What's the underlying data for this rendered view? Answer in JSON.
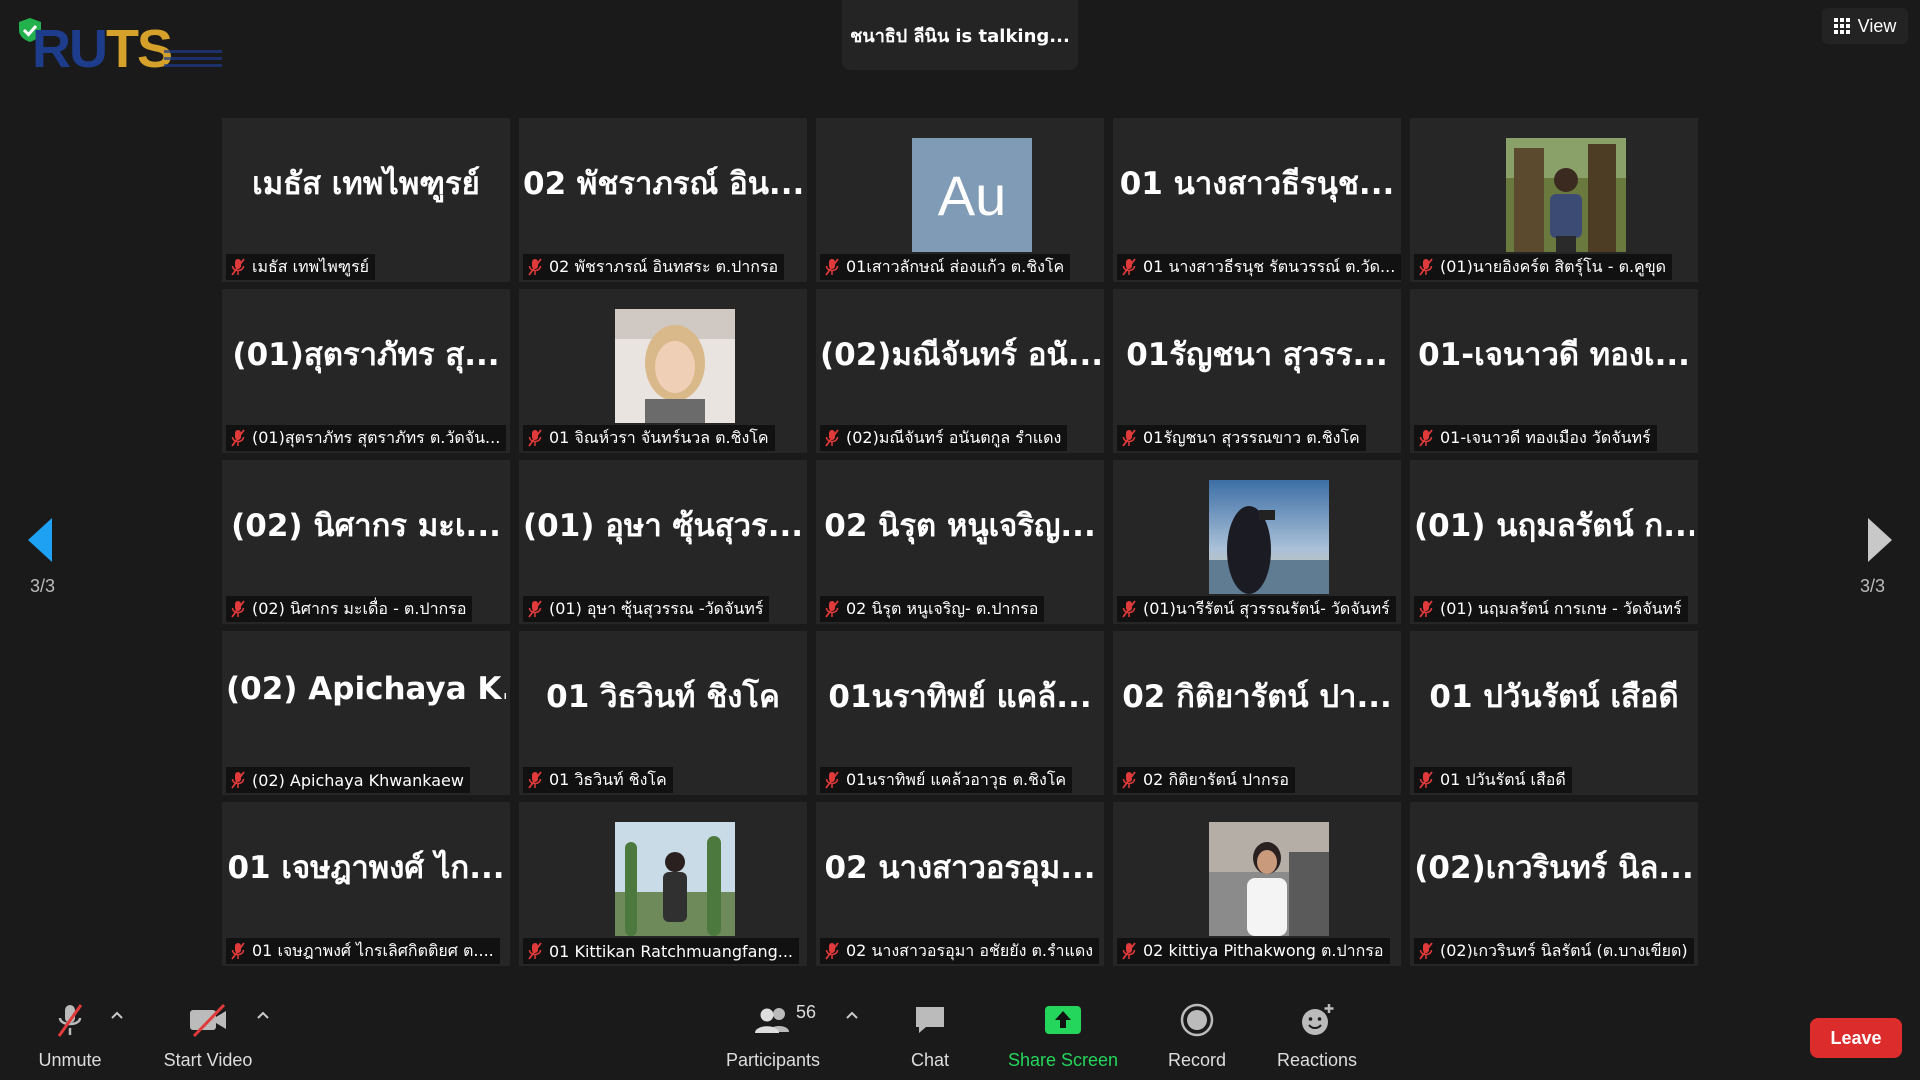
{
  "logo": {
    "text_a": "RU",
    "text_b": "TS"
  },
  "banner": {
    "talking": "ชนาธิป ลีนิน is talking..."
  },
  "view": {
    "label": "View"
  },
  "paging": {
    "left": "3/3",
    "right": "3/3"
  },
  "tiles": [
    {
      "big": "เมธัส เทพไพฑูรย์",
      "label": "เมธัส เทพไพฑูรย์"
    },
    {
      "big": "02 พัชราภรณ์ อิน...",
      "label": "02 พัชราภรณ์ อินทสระ ต.ปากรอ"
    },
    {
      "avatar": "Au",
      "label": "01เสาวลักษณ์ ส่องแก้ว ต.ชิงโค"
    },
    {
      "big": "01 นางสาวธีรนุช...",
      "label": "01 นางสาวธีรนุช รัตนวรรณ์ ต.วัด..."
    },
    {
      "photo": "man-outdoors",
      "label": "(01)นายอิงคร์ต สิตรุ์โน - ต.คูขุด"
    },
    {
      "big": "(01)สุตราภัทร สุ...",
      "label": "(01)สุตราภัทร สุตราภัทร ต.วัดจัน..."
    },
    {
      "photo": "woman-portrait",
      "label": "01 จิณห์วรา จันทร์นวล ต.ชิงโค"
    },
    {
      "big": "(02)มณีจันทร์ อนั...",
      "label": "(02)มณีจันทร์ อนันตกูล รำแดง"
    },
    {
      "big": "01รัญชนา สุวรร...",
      "label": "01รัญชนา สุวรรณขาว ต.ชิงโค"
    },
    {
      "big": "01-เจนาวดี ทองเ...",
      "label": "01-เจนาวดี ทองเมือง วัดจันทร์"
    },
    {
      "big": "(02) นิศากร มะเ...",
      "label": "(02) นิศากร มะเดื่อ - ต.ปากรอ"
    },
    {
      "big": "(01) อุษา ซุ้นสุวร...",
      "label": "(01) อุษา ซุ้นสุวรรณ -วัดจันทร์"
    },
    {
      "big": "02 นิรุต หนูเจริญ...",
      "label": "02 นิรุต หนูเจริญ- ต.ปากรอ"
    },
    {
      "photo": "sunset-photo",
      "label": "(01)นารีรัตน์ สุวรรณรัตน์- วัดจันทร์"
    },
    {
      "big": "(01) นฤมลรัตน์ ก...",
      "label": "(01) นฤมลรัตน์ การเกษ - วัดจันทร์"
    },
    {
      "big": "(02) Apichaya K...",
      "label": "(02) Apichaya Khwankaew"
    },
    {
      "big": "01 วิธวินท์ ชิงโค",
      "label": "01 วิธวินท์ ชิงโค"
    },
    {
      "big": "01นราทิพย์ แคล้...",
      "label": "01นราทิพย์ แคล้วอาวุธ ต.ชิงโค"
    },
    {
      "big": "02 กิติยารัตน์ ปา...",
      "label": "02 กิติยารัตน์ ปากรอ"
    },
    {
      "big": "01 ปวันรัตน์ เสือดี",
      "label": "01 ปวันรัตน์ เสือดี"
    },
    {
      "big": "01 เจษฎาพงศ์ ไก...",
      "label": "01 เจษฎาพงศ์ ไกรเลิศกิตติยศ ต...."
    },
    {
      "photo": "cactus-photo",
      "label": "01 Kittikan Ratchmuangfang..."
    },
    {
      "big": "02 นางสาวอรอุม...",
      "label": "02 นางสาวอรอุมา อชัยยัง ต.รำแดง"
    },
    {
      "photo": "student-photo",
      "label": "02 kittiya Pithakwong ต.ปากรอ"
    },
    {
      "big": "(02)เกวรินทร์ นิล...",
      "label": "(02)เกวรินทร์ นิลรัตน์ (ต.บางเขียด)"
    }
  ],
  "toolbar": {
    "unmute": "Unmute",
    "start_video": "Start Video",
    "participants": "Participants",
    "participants_count": "56",
    "chat": "Chat",
    "share_screen": "Share Screen",
    "record": "Record",
    "reactions": "Reactions",
    "leave": "Leave"
  },
  "colors": {
    "share_green": "#24d65b",
    "leave_red": "#dc2c2c",
    "arrow_blue": "#1ea1f2",
    "muted_red": "#e03a3a"
  }
}
